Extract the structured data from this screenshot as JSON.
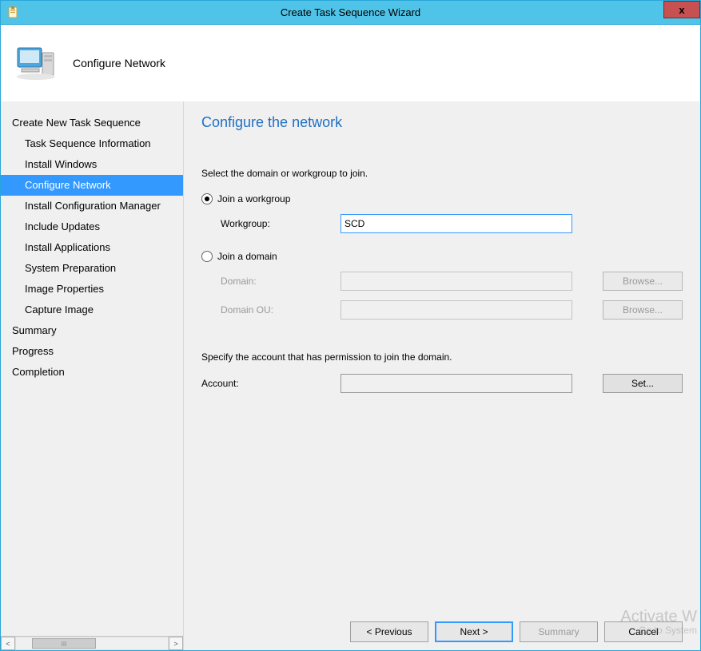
{
  "window": {
    "title": "Create Task Sequence Wizard",
    "close_glyph": "x"
  },
  "header": {
    "page_title": "Configure Network"
  },
  "sidebar": {
    "items": [
      {
        "label": "Create New Task Sequence",
        "indent": false,
        "selected": false
      },
      {
        "label": "Task Sequence Information",
        "indent": true,
        "selected": false
      },
      {
        "label": "Install Windows",
        "indent": true,
        "selected": false
      },
      {
        "label": "Configure Network",
        "indent": true,
        "selected": true
      },
      {
        "label": "Install Configuration Manager",
        "indent": true,
        "selected": false
      },
      {
        "label": "Include Updates",
        "indent": true,
        "selected": false
      },
      {
        "label": "Install Applications",
        "indent": true,
        "selected": false
      },
      {
        "label": "System Preparation",
        "indent": true,
        "selected": false
      },
      {
        "label": "Image Properties",
        "indent": true,
        "selected": false
      },
      {
        "label": "Capture Image",
        "indent": true,
        "selected": false
      },
      {
        "label": "Summary",
        "indent": false,
        "selected": false
      },
      {
        "label": "Progress",
        "indent": false,
        "selected": false
      },
      {
        "label": "Completion",
        "indent": false,
        "selected": false
      }
    ],
    "scroll_left_glyph": "<",
    "scroll_right_glyph": ">",
    "thumb_glyph": "III"
  },
  "content": {
    "heading": "Configure the network",
    "instruction": "Select the domain or workgroup to join.",
    "radio_workgroup_label": "Join a workgroup",
    "workgroup_label": "Workgroup:",
    "workgroup_value": "SCD",
    "radio_domain_label": "Join a domain",
    "domain_label": "Domain:",
    "domain_value": "",
    "domain_ou_label": "Domain OU:",
    "domain_ou_value": "",
    "browse_label": "Browse...",
    "specify_text": "Specify the account that has permission to join the domain.",
    "account_label": "Account:",
    "account_value": "",
    "set_label": "Set..."
  },
  "footer": {
    "previous_label": "< Previous",
    "next_label": "Next >",
    "summary_label": "Summary",
    "cancel_label": "Cancel"
  },
  "watermark": {
    "line1": "Activate W",
    "line2": "Go to System"
  }
}
